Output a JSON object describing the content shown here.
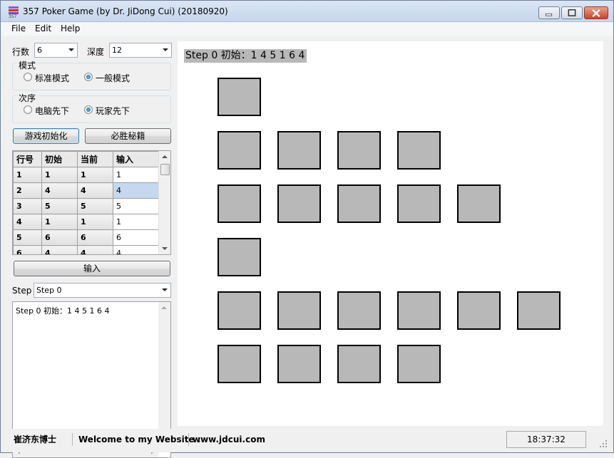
{
  "window": {
    "title": "357 Poker Game (by Dr. JiDong Cui) (20180920)"
  },
  "menu": [
    "File",
    "Edit",
    "Help"
  ],
  "settings": {
    "rows_label": "行数",
    "rows_value": "6",
    "depth_label": "深度",
    "depth_value": "12",
    "mode": {
      "title": "模式",
      "options": [
        "标准模式",
        "一般模式"
      ],
      "selected": "一般模式"
    },
    "order": {
      "title": "次序",
      "options": [
        "电脑先下",
        "玩家先下"
      ],
      "selected": "玩家先下"
    }
  },
  "buttons": {
    "init": "游戏初始化",
    "secret": "必胜秘籍",
    "input": "输入"
  },
  "grid": {
    "headers": [
      "行号",
      "初始",
      "当前",
      "输入"
    ],
    "rows": [
      [
        "1",
        "1",
        "1",
        "1"
      ],
      [
        "2",
        "4",
        "4",
        "4"
      ],
      [
        "3",
        "5",
        "5",
        "5"
      ],
      [
        "4",
        "1",
        "1",
        "1"
      ],
      [
        "5",
        "6",
        "6",
        "6"
      ],
      [
        "6",
        "4",
        "4",
        "4"
      ]
    ],
    "selected_row": 1
  },
  "step": {
    "label": "Step",
    "value": "Step 0"
  },
  "log": [
    "Step 0 初始：1 4 5 1 6 4"
  ],
  "board": {
    "title": "Step 0 初始：1 4 5 1 6 4",
    "rows": [
      1,
      4,
      5,
      1,
      6,
      4
    ],
    "card_color": "#b8b8b8"
  },
  "status": {
    "author": "崔济东博士",
    "welcome": "Welcome to my Website :",
    "website": "www.jdcui.com",
    "time": "18:37:32"
  }
}
